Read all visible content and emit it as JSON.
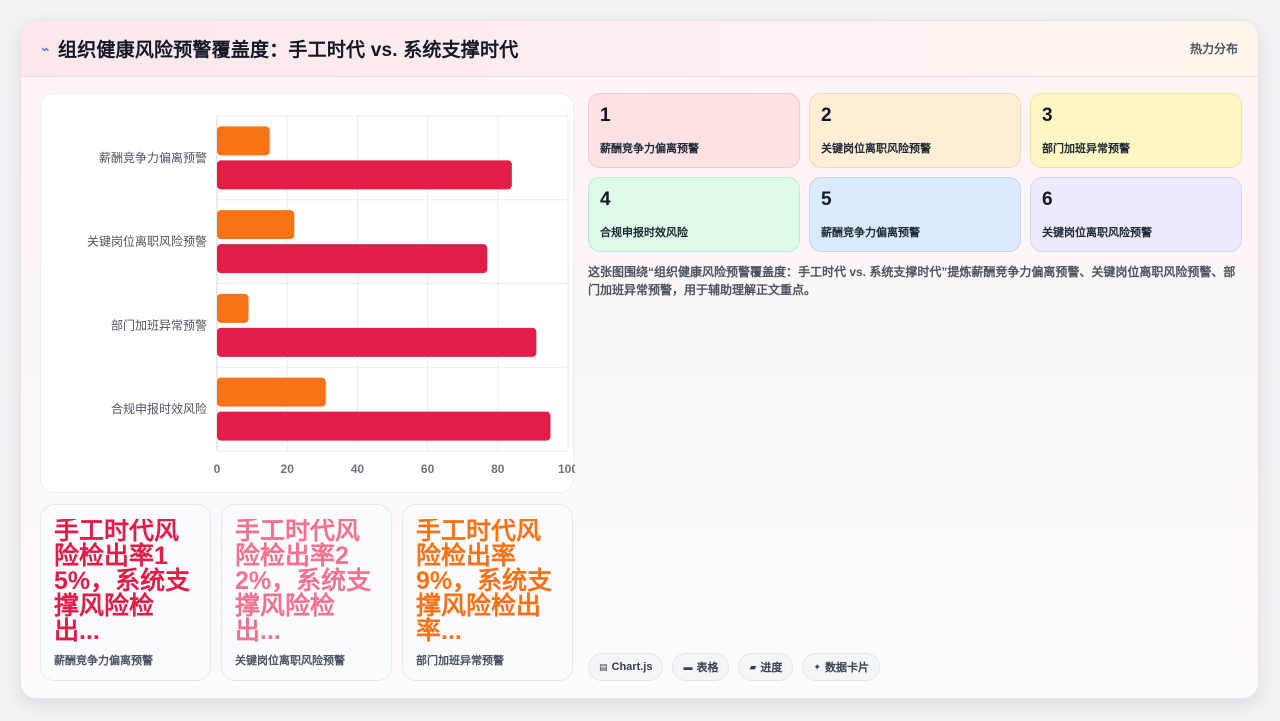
{
  "header": {
    "icon": "wave-icon",
    "title": "组织健康风险预警覆盖度：手工时代 vs. 系统支撑时代",
    "right_link": "热力分布"
  },
  "colors": {
    "manual": "#f97316",
    "system": "#e11d48",
    "accent_pink": "#f0738f"
  },
  "chart_data": {
    "type": "bar",
    "orientation": "horizontal",
    "categories": [
      "薪酬竞争力偏离预警",
      "关键岗位离职风险预警",
      "部门加班异常预警",
      "合规申报时效风险"
    ],
    "series": [
      {
        "color": "#f97316",
        "values": [
          15,
          22,
          9,
          31
        ]
      },
      {
        "color": "#e11d48",
        "values": [
          84,
          77,
          91,
          95
        ]
      }
    ],
    "xlim": [
      0,
      100
    ],
    "xticks": [
      "0",
      "20",
      "40",
      "60",
      "80",
      "100"
    ],
    "grid": true,
    "legend": "none"
  },
  "stat_cards": [
    {
      "text": "手工时代风险检出率15%，系统支撑风险检出...",
      "label": "薪酬竞争力偏离预警",
      "color": "#e11d48"
    },
    {
      "text": "手工时代风险检出率22%，系统支撑风险检出...",
      "label": "关键岗位离职风险预警",
      "color": "#f0738f"
    },
    {
      "text": "手工时代风险检出率9%，系统支撑风险检出率...",
      "label": "部门加班异常预警",
      "color": "#f97316"
    }
  ],
  "tiles": [
    {
      "num": "1",
      "name": "薪酬竞争力偏离预警",
      "bg": "#fde2e4",
      "border": "#f5c8cd"
    },
    {
      "num": "2",
      "name": "关键岗位离职风险预警",
      "bg": "#ffedd5",
      "border": "#f8d9b4"
    },
    {
      "num": "3",
      "name": "部门加班异常预警",
      "bg": "#fef7c3",
      "border": "#f2e59c"
    },
    {
      "num": "4",
      "name": "合规申报时效风险",
      "bg": "#dcfce7",
      "border": "#bfecd0"
    },
    {
      "num": "5",
      "name": "薪酬竞争力偏离预警",
      "bg": "#dbeafe",
      "border": "#c1d7f5"
    },
    {
      "num": "6",
      "name": "关键岗位离职风险预警",
      "bg": "#ede9fe",
      "border": "#d9d1f7"
    }
  ],
  "description": "这张图围绕“组织健康风险预警覆盖度：手工时代 vs. 系统支撑时代”提炼薪酬竞争力偏离预警、关键岗位离职风险预警、部门加班异常预警，用于辅助理解正文重点。",
  "chips": [
    {
      "icon": "chart-icon",
      "glyph": "▤",
      "label": "Chart.js"
    },
    {
      "icon": "table-icon",
      "glyph": "▬",
      "label": "表格"
    },
    {
      "icon": "progress-icon",
      "glyph": "▰",
      "label": "进度"
    },
    {
      "icon": "data-card-icon",
      "glyph": "✦",
      "label": "数据卡片"
    }
  ]
}
